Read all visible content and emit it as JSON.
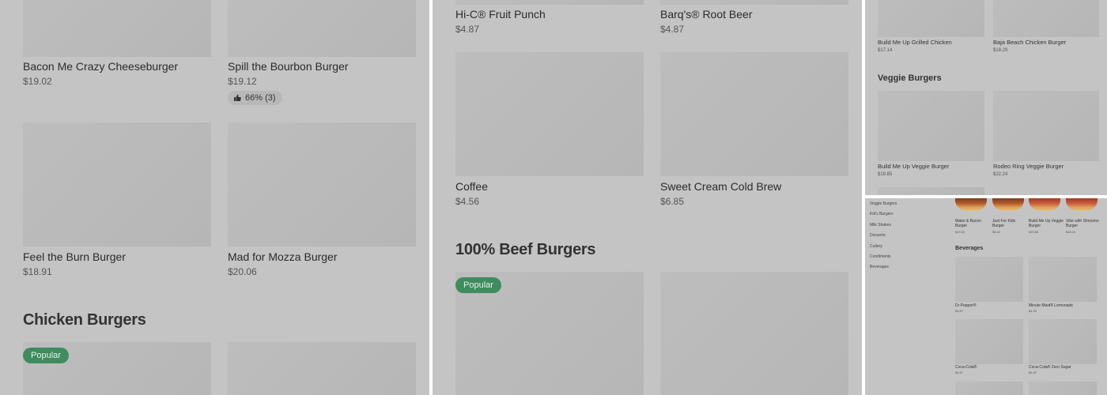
{
  "panel1": {
    "items": [
      {
        "name": "Bacon Me Crazy Cheeseburger",
        "price": "$19.02"
      },
      {
        "name": "Spill the Bourbon Burger",
        "price": "$19.12",
        "rating": "66% (3)"
      },
      {
        "name": "Feel the Burn Burger",
        "price": "$18.91"
      },
      {
        "name": "Mad for Mozza Burger",
        "price": "$20.06"
      }
    ],
    "section": "Chicken Burgers",
    "badge": "Popular"
  },
  "panel2": {
    "items": [
      {
        "name": "Hi-C® Fruit Punch",
        "price": "$4.87"
      },
      {
        "name": "Barq's® Root Beer",
        "price": "$4.87"
      },
      {
        "name": "Coffee",
        "price": "$4.56"
      },
      {
        "name": "Sweet Cream Cold Brew",
        "price": "$6.85"
      }
    ],
    "section": "100% Beef Burgers",
    "badge": "Popular"
  },
  "panel3": {
    "items": [
      {
        "name": "Build Me Up Grilled Chicken",
        "price": "$17.14"
      },
      {
        "name": "Baja Beach Chicken Burger",
        "price": "$18.29"
      },
      {
        "name": "Build Me Up Veggie Burger",
        "price": "$19.85"
      },
      {
        "name": "Rodeo Ring Veggie Burger",
        "price": "$22.24"
      }
    ],
    "section": "Veggie Burgers"
  },
  "panel4": {
    "nav": [
      "Veggie Burgers",
      "Kid's Burgers",
      "Milk Shakes",
      "Desserts",
      "Cutlery",
      "Condiments",
      "Beverages"
    ],
    "top_items": [
      {
        "name": "Wake & Bacon Burger",
        "price": "$19.02"
      },
      {
        "name": "Just For Kids Burger",
        "price": "$6.42"
      },
      {
        "name": "Build Me Up Veggie Burger",
        "price": "$19.85"
      },
      {
        "name": "Vibe with Shrooms Burger",
        "price": "$18.10"
      }
    ],
    "section": "Beverages",
    "items": [
      {
        "name": "Dr Pepper®",
        "price": "$4.87"
      },
      {
        "name": "Minute Maid® Lemonade",
        "price": "$4.99"
      },
      {
        "name": "Coca-Cola®",
        "price": "$4.87"
      },
      {
        "name": "Coca-Cola® Zero Sugar",
        "price": "$4.87"
      }
    ]
  },
  "colors": {
    "badge": "#3f8c5e",
    "overlay": "#c4c4c4"
  },
  "icons": {
    "rating": "thumbs-up-icon"
  }
}
